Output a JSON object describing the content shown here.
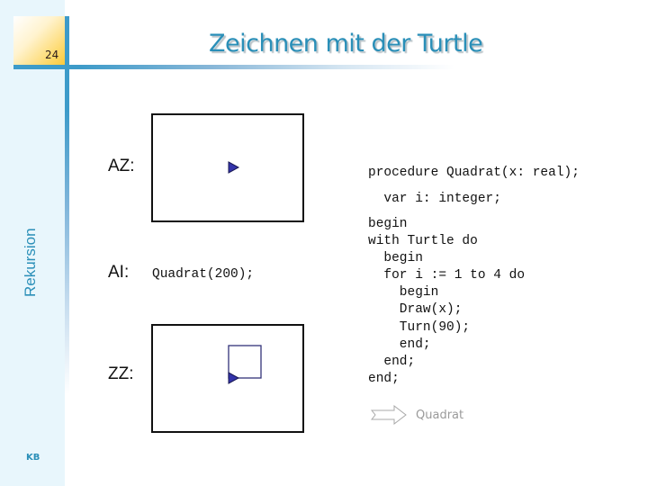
{
  "slide": {
    "number": "24",
    "title": "Zeichnen mit der Turtle",
    "side_label": "Rekursion",
    "footer_initials": "KB"
  },
  "colors": {
    "accent": "#2a8fb8",
    "line": "#3d9bc9",
    "turtle": "#3333aa",
    "sidebar_bg": "#e8f6fc"
  },
  "states": {
    "initial": {
      "label": "AZ:",
      "turtle_heading": "east",
      "icon": "turtle-triangle-icon"
    },
    "instruction": {
      "label": "AI:",
      "code": "Quadrat(200);"
    },
    "final": {
      "label": "ZZ:",
      "turtle_heading": "east",
      "drawn_shape": "square",
      "icon": "turtle-triangle-icon"
    }
  },
  "procedure": {
    "lines": [
      "procedure Quadrat(x: real);",
      "  var i: integer;",
      "begin",
      "with Turtle do",
      "  begin",
      "  for i := 1 to 4 do",
      "    begin",
      "    Draw(x);",
      "    Turn(90);",
      "    end;",
      "  end;",
      "end;"
    ]
  },
  "link": {
    "icon": "hollow-arrow-right-icon",
    "label": "Quadrat"
  }
}
